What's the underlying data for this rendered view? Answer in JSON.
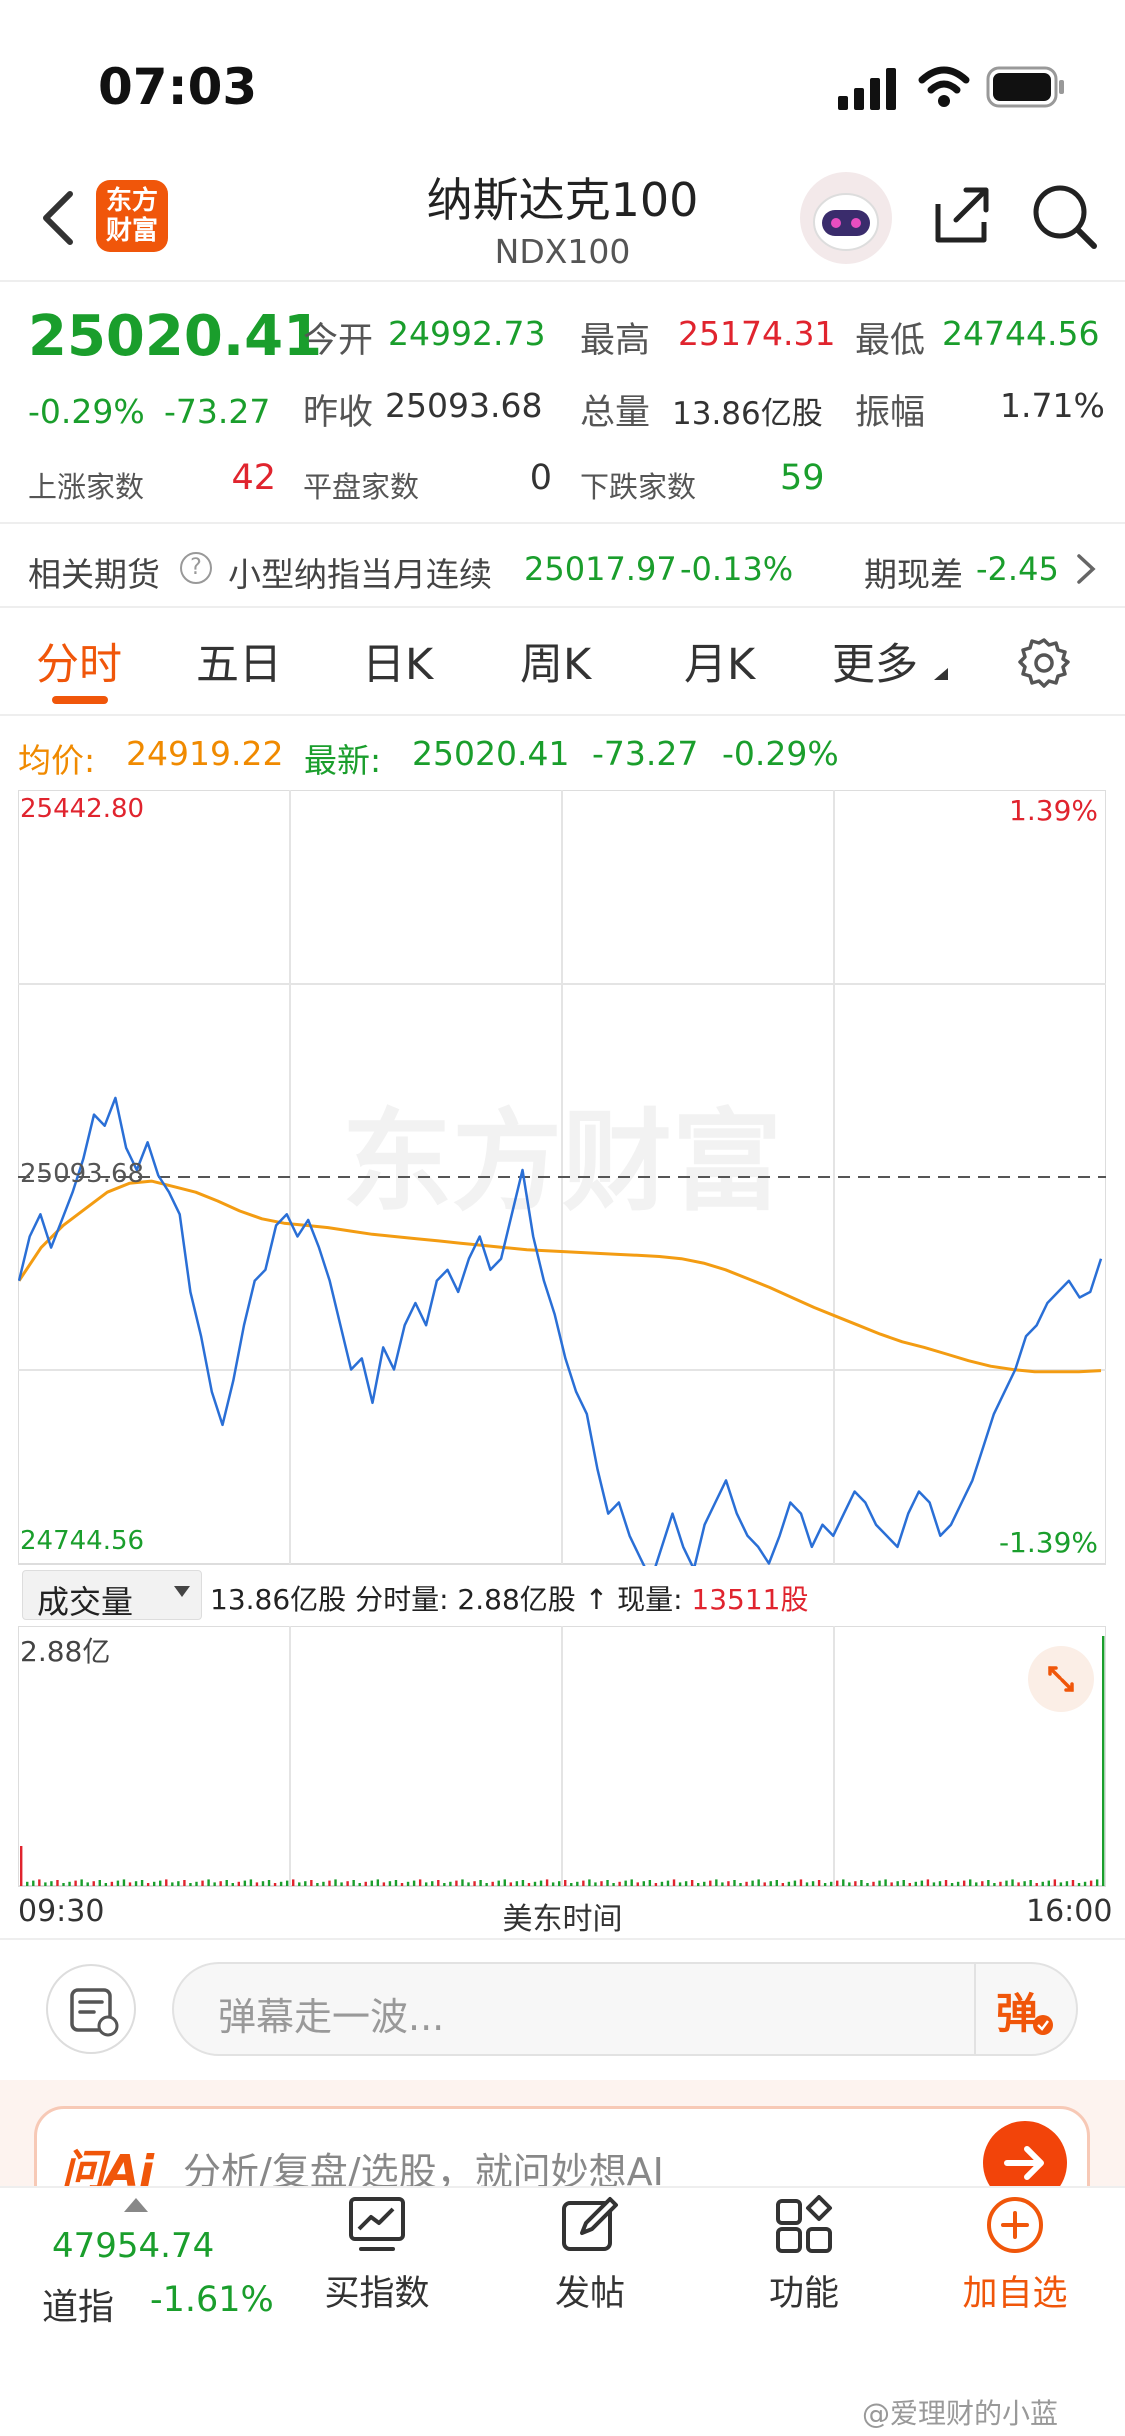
{
  "status_bar": {
    "time": "07:03"
  },
  "nav": {
    "title": "纳斯达克100",
    "subtitle": "NDX100",
    "logo_line1": "东方",
    "logo_line2": "财富"
  },
  "quote": {
    "price": "25020.41",
    "change_pct": "-0.29%",
    "change": "-73.27",
    "open_label": "今开",
    "open": "24992.73",
    "high_label": "最高",
    "high": "25174.31",
    "low_label": "最低",
    "low": "24744.56",
    "prev_close_label": "昨收",
    "prev_close": "25093.68",
    "volume_label": "总量",
    "volume": "13.86亿股",
    "amplitude_label": "振幅",
    "amplitude": "1.71%",
    "up_label": "上涨家数",
    "up_count": "42",
    "flat_label": "平盘家数",
    "flat_count": "0",
    "down_label": "下跌家数",
    "down_count": "59"
  },
  "futures": {
    "label": "相关期货",
    "name": "小型纳指当月连续",
    "price": "25017.97",
    "pct": "-0.13%",
    "basis_label": "期现差",
    "basis": "-2.45"
  },
  "tabs": [
    "分时",
    "五日",
    "日K",
    "周K",
    "月K",
    "更多"
  ],
  "chart_header": {
    "avg_label": "均价:",
    "avg": "24919.22",
    "latest_label": "最新:",
    "latest": "25020.41",
    "latest_change": "-73.27",
    "latest_pct": "-0.29%"
  },
  "chart_data": {
    "type": "line",
    "y_top_label": "25442.80",
    "y_bottom_label": "24744.56",
    "ref_label": "25093.68",
    "right_top_pct": "1.39%",
    "right_bottom_pct": "-1.39%",
    "ylim": [
      24744.56,
      25442.8
    ],
    "ref_value": 25093.68,
    "series": [
      {
        "color": "#2a6fd6",
        "values": [
          25000,
          25040,
          25060,
          25030,
          25055,
          25080,
          25110,
          25150,
          25140,
          25165,
          25120,
          25100,
          25125,
          25095,
          25080,
          25060,
          24990,
          24950,
          24900,
          24870,
          24910,
          24960,
          25000,
          25010,
          25050,
          25060,
          25040,
          25055,
          25030,
          25000,
          24960,
          24920,
          24930,
          24890,
          24940,
          24920,
          24960,
          24980,
          24960,
          25000,
          25010,
          24990,
          25020,
          25040,
          25010,
          25020,
          25060,
          25100,
          25040,
          25000,
          24970,
          24930,
          24900,
          24880,
          24830,
          24790,
          24800,
          24770,
          24750,
          24730,
          24760,
          24790,
          24760,
          24740,
          24780,
          24800,
          24820,
          24790,
          24770,
          24760,
          24745,
          24770,
          24800,
          24790,
          24760,
          24780,
          24770,
          24790,
          24810,
          24800,
          24780,
          24770,
          24760,
          24790,
          24810,
          24800,
          24770,
          24780,
          24800,
          24820,
          24850,
          24880,
          24900,
          24920,
          24950,
          24960,
          24980,
          24990,
          25000,
          24985,
          24990,
          25020
        ]
      },
      {
        "color": "#f39c12",
        "values": [
          25000,
          25030,
          25050,
          25065,
          25080,
          25088,
          25090,
          25085,
          25080,
          25072,
          25063,
          25056,
          25052,
          25050,
          25048,
          25045,
          25042,
          25040,
          25038,
          25036,
          25034,
          25032,
          25030,
          25028,
          25027,
          25026,
          25025,
          25024,
          25023,
          25022,
          25020,
          25016,
          25010,
          25002,
          24994,
          24985,
          24976,
          24968,
          24960,
          24952,
          24945,
          24940,
          24934,
          24928,
          24923,
          24920,
          24918,
          24918,
          24918,
          24919
        ]
      }
    ],
    "x_start": "09:30",
    "x_mid": "美东时间",
    "x_end": "16:00"
  },
  "volume_bar": {
    "selector": "成交量",
    "total": "13.86亿股",
    "period_label": "分时量:",
    "period": "2.88亿股",
    "arrow": "↑",
    "current_label": "现量:",
    "current": "13511股",
    "y_max": "2.88亿"
  },
  "danmaku": {
    "placeholder": "弹幕走一波...",
    "send": "弹"
  },
  "ai": {
    "logo": "问Ai",
    "text": "分析/复盘/选股，就问妙想AI"
  },
  "bottom": {
    "index_value": "47954.74",
    "index_name": "道指",
    "index_pct": "-1.61%",
    "buy_index": "买指数",
    "post": "发帖",
    "functions": "功能",
    "add_watch": "加自选"
  },
  "watermark": "@爱理财的小蓝",
  "chart_watermark": "东方财富"
}
